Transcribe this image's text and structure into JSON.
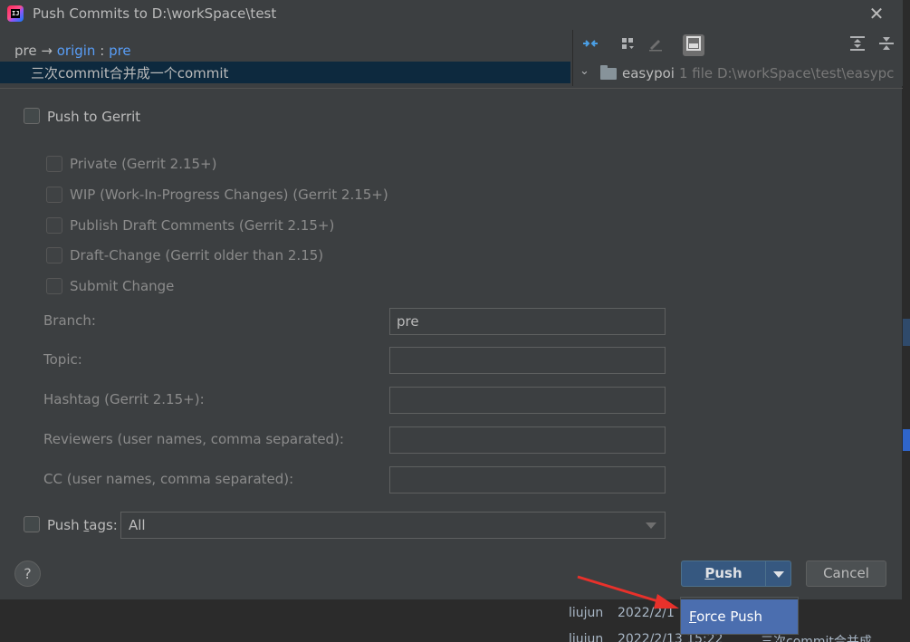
{
  "dialog": {
    "title": "Push Commits to D:\\workSpace\\test",
    "app_icon": "intellij-idea-icon",
    "close_glyph": "✕"
  },
  "commits": {
    "local_branch": "pre",
    "arrow": "→",
    "remote": "origin",
    "separator": ":",
    "remote_branch": "pre",
    "commit_message": "三次commit合并成一个commit"
  },
  "changes": {
    "toolbar_icons": [
      "show-diff-icon",
      "group-by-icon",
      "edit-source-icon",
      "preview-diff-icon",
      "expand-all-icon",
      "collapse-all-icon"
    ],
    "folder_name": "easypoi",
    "file_count": "1 file",
    "folder_path": "D:\\workSpace\\test\\easypc"
  },
  "gerrit": {
    "push_to_gerrit": "Push to Gerrit",
    "options": [
      "Private (Gerrit 2.15+)",
      "WIP (Work-In-Progress Changes) (Gerrit 2.15+)",
      "Publish Draft Comments (Gerrit 2.15+)",
      "Draft-Change (Gerrit older than 2.15)",
      "Submit Change"
    ],
    "fields": {
      "branch_label": "Branch:",
      "branch_value": "pre",
      "topic_label": "Topic:",
      "hashtag_label": "Hashtag (Gerrit 2.15+):",
      "reviewers_label": "Reviewers (user names, comma separated):",
      "cc_label": "CC (user names, comma separated):"
    }
  },
  "push_tags": {
    "label_prefix": "Push ",
    "label_mnemonic": "t",
    "label_suffix": "ags:",
    "selected": "All"
  },
  "buttons": {
    "help": "?",
    "push_mnemonic": "P",
    "push_rest": "ush",
    "cancel": "Cancel"
  },
  "popup": {
    "force_push_mnemonic": "F",
    "force_push_rest": "orce Push"
  },
  "background_log": {
    "row1_author": "liujun",
    "row1_date": "2022/2/1",
    "row2_author": "liujun",
    "row2_date": "2022/2/13 15:22",
    "row2_msg": "三次commit合并成"
  },
  "colors": {
    "accent": "#589df6",
    "selection": "#0d293e",
    "push_button": "#365880",
    "popup_selected": "#4b6eaf",
    "annotation_arrow": "#e8312b"
  }
}
